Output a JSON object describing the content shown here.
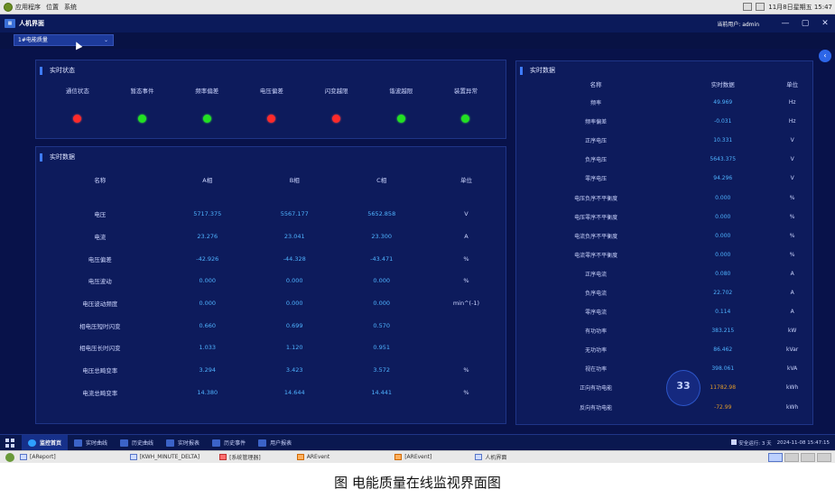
{
  "os_bar": {
    "menus": [
      "应用程序",
      "位置",
      "系统"
    ],
    "clock": "11月8日星期五 15:47"
  },
  "app": {
    "title": "人机界面",
    "current_user": "当前用户: admin",
    "minimize": "—",
    "restore": "▢",
    "close": "✕"
  },
  "device_selector": {
    "value": "1#电能质量"
  },
  "status_panel": {
    "title": "实时状态",
    "items": [
      {
        "label": "通信状态",
        "state": "red"
      },
      {
        "label": "暂态事件",
        "state": "green"
      },
      {
        "label": "频率偏差",
        "state": "green"
      },
      {
        "label": "电压偏差",
        "state": "red"
      },
      {
        "label": "闪变越限",
        "state": "red"
      },
      {
        "label": "谐波越限",
        "state": "green"
      },
      {
        "label": "装置异常",
        "state": "green"
      }
    ]
  },
  "phase_panel": {
    "title": "实时数据",
    "headers": [
      "名称",
      "A相",
      "B相",
      "C相",
      "单位"
    ],
    "rows": [
      {
        "name": "电压",
        "a": "5717.375",
        "b": "5567.177",
        "c": "5652.858",
        "unit": "V"
      },
      {
        "name": "电流",
        "a": "23.276",
        "b": "23.041",
        "c": "23.300",
        "unit": "A"
      },
      {
        "name": "电压偏差",
        "a": "-42.926",
        "b": "-44.328",
        "c": "-43.471",
        "unit": "%"
      },
      {
        "name": "电压波动",
        "a": "0.000",
        "b": "0.000",
        "c": "0.000",
        "unit": "%"
      },
      {
        "name": "电压波动频度",
        "a": "0.000",
        "b": "0.000",
        "c": "0.000",
        "unit": "min^(-1)"
      },
      {
        "name": "相电压短时闪变",
        "a": "0.660",
        "b": "0.699",
        "c": "0.570",
        "unit": ""
      },
      {
        "name": "相电压长时闪变",
        "a": "1.033",
        "b": "1.120",
        "c": "0.951",
        "unit": ""
      },
      {
        "name": "电压总畸变率",
        "a": "3.294",
        "b": "3.423",
        "c": "3.572",
        "unit": "%"
      },
      {
        "name": "电流总畸变率",
        "a": "14.380",
        "b": "14.644",
        "c": "14.441",
        "unit": "%"
      }
    ]
  },
  "right_panel": {
    "title": "实时数据",
    "headers": [
      "名称",
      "实时数据",
      "单位"
    ],
    "rows": [
      {
        "name": "频率",
        "value": "49.969",
        "unit": "Hz"
      },
      {
        "name": "频率偏差",
        "value": "-0.031",
        "unit": "Hz"
      },
      {
        "name": "正序电压",
        "value": "10.331",
        "unit": "V"
      },
      {
        "name": "负序电压",
        "value": "5643.375",
        "unit": "V"
      },
      {
        "name": "零序电压",
        "value": "94.296",
        "unit": "V"
      },
      {
        "name": "电压负序不平衡度",
        "value": "0.000",
        "unit": "%"
      },
      {
        "name": "电压零序不平衡度",
        "value": "0.000",
        "unit": "%"
      },
      {
        "name": "电流负序不平衡度",
        "value": "0.000",
        "unit": "%"
      },
      {
        "name": "电流零序不平衡度",
        "value": "0.000",
        "unit": "%"
      },
      {
        "name": "正序电流",
        "value": "0.080",
        "unit": "A"
      },
      {
        "name": "负序电流",
        "value": "22.702",
        "unit": "A"
      },
      {
        "name": "零序电流",
        "value": "0.114",
        "unit": "A"
      },
      {
        "name": "有功功率",
        "value": "383.215",
        "unit": "kW"
      },
      {
        "name": "无功功率",
        "value": "86.462",
        "unit": "kVar"
      },
      {
        "name": "视在功率",
        "value": "398.061",
        "unit": "kVA"
      },
      {
        "name": "正向有功电能",
        "value": "11782.98",
        "unit": "kWh"
      },
      {
        "name": "反向有功电能",
        "value": "-72.99",
        "unit": "kWh"
      }
    ],
    "badge": "33"
  },
  "bottom_nav": {
    "items": [
      "监控首页",
      "实时曲线",
      "历史曲线",
      "实时报表",
      "历史事件",
      "用户报表"
    ],
    "runtime": "安全运行: 3 天",
    "datetime": "2024-11-08 15:47:15"
  },
  "taskbar": {
    "items": [
      "[AReport]",
      "[KWH_MINUTE_DELTA]",
      "[系统管理器]",
      "AREvent",
      "[AREvent]",
      "人机界面"
    ]
  },
  "caption": "图  电能质量在线监视界面图"
}
